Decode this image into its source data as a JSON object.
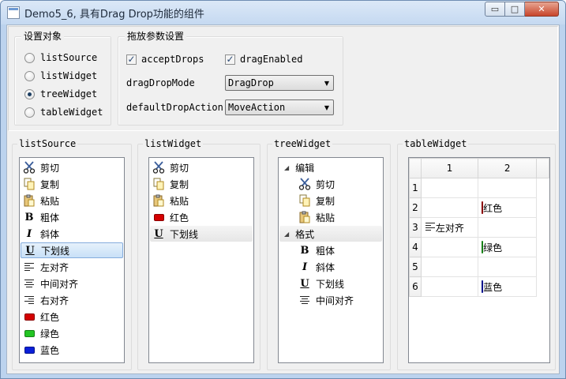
{
  "window": {
    "title": "Demo5_6, 具有Drag Drop功能的组件",
    "min_label": "▭",
    "max_label": "□",
    "close_label": "✕"
  },
  "settings": {
    "target_group_title": "设置对象",
    "targets": [
      {
        "label": "listSource",
        "checked": false
      },
      {
        "label": "listWidget",
        "checked": false
      },
      {
        "label": "treeWidget",
        "checked": true
      },
      {
        "label": "tableWidget",
        "checked": false
      }
    ],
    "params_group_title": "拖放参数设置",
    "accept_drops_label": "acceptDrops",
    "accept_drops_checked": true,
    "drag_enabled_label": "dragEnabled",
    "drag_enabled_checked": true,
    "drag_drop_mode_label": "dragDropMode",
    "drag_drop_mode_value": "DragDrop",
    "default_drop_action_label": "defaultDropAction",
    "default_drop_action_value": "MoveAction"
  },
  "list_source": {
    "title": "listSource",
    "items": [
      {
        "label": "剪切",
        "icon": "scissors-icon"
      },
      {
        "label": "复制",
        "icon": "copy-icon"
      },
      {
        "label": "粘贴",
        "icon": "paste-icon"
      },
      {
        "label": "粗体",
        "icon": "bold-icon"
      },
      {
        "label": "斜体",
        "icon": "italic-icon"
      },
      {
        "label": "下划线",
        "icon": "underline-icon",
        "selected": true
      },
      {
        "label": "左对齐",
        "icon": "align-left-icon"
      },
      {
        "label": "中间对齐",
        "icon": "align-center-icon"
      },
      {
        "label": "右对齐",
        "icon": "align-right-icon"
      },
      {
        "label": "红色",
        "icon": "red-swatch-icon"
      },
      {
        "label": "绿色",
        "icon": "green-swatch-icon"
      },
      {
        "label": "蓝色",
        "icon": "blue-swatch-icon"
      }
    ]
  },
  "list_widget": {
    "title": "listWidget",
    "items": [
      {
        "label": "剪切",
        "icon": "scissors-icon"
      },
      {
        "label": "复制",
        "icon": "copy-icon"
      },
      {
        "label": "粘贴",
        "icon": "paste-icon"
      },
      {
        "label": "红色",
        "icon": "red-swatch-icon"
      },
      {
        "label": "下划线",
        "icon": "underline-icon",
        "hover": true
      }
    ]
  },
  "tree_widget": {
    "title": "treeWidget",
    "groups": [
      {
        "label": "编辑",
        "children": [
          {
            "label": "剪切",
            "icon": "scissors-icon"
          },
          {
            "label": "复制",
            "icon": "copy-icon"
          },
          {
            "label": "粘贴",
            "icon": "paste-icon"
          }
        ]
      },
      {
        "label": "格式",
        "children": [
          {
            "label": "粗体",
            "icon": "bold-icon"
          },
          {
            "label": "斜体",
            "icon": "italic-icon"
          },
          {
            "label": "下划线",
            "icon": "underline-icon"
          },
          {
            "label": "中间对齐",
            "icon": "align-center-icon"
          }
        ]
      }
    ]
  },
  "table_widget": {
    "title": "tableWidget",
    "columns": [
      "1",
      "2"
    ],
    "rows": [
      {
        "header": "1",
        "c1": "",
        "c1_icon": "",
        "c2": "",
        "c2_icon": ""
      },
      {
        "header": "2",
        "c1": "",
        "c1_icon": "",
        "c2": "红色",
        "c2_icon": "red-swatch-icon"
      },
      {
        "header": "3",
        "c1": "左对齐",
        "c1_icon": "align-left-icon",
        "c2": "",
        "c2_icon": ""
      },
      {
        "header": "4",
        "c1": "",
        "c1_icon": "",
        "c2": "绿色",
        "c2_icon": "green-swatch-icon"
      },
      {
        "header": "5",
        "c1": "",
        "c1_icon": "",
        "c2": "",
        "c2_icon": ""
      },
      {
        "header": "6",
        "c1": "",
        "c1_icon": "",
        "c2": "蓝色",
        "c2_icon": "blue-swatch-icon"
      }
    ]
  },
  "colors": {
    "red": "#d40000",
    "green": "#22c422",
    "blue": "#0a1fd8",
    "selection": "#c8e0f7"
  }
}
